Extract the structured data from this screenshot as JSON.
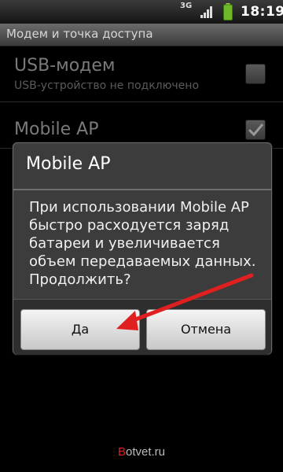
{
  "status_bar": {
    "network": "3G",
    "time": "18:19",
    "icons": [
      "network-3g-icon",
      "signal-icon",
      "battery-icon"
    ]
  },
  "title_bar": {
    "title": "Модем и точка доступа"
  },
  "settings": [
    {
      "title": "USB-модем",
      "subtitle": "USB-устройство не подключено",
      "checked": false
    },
    {
      "title": "Mobile AP",
      "subtitle": "",
      "checked": true
    }
  ],
  "dialog": {
    "title": "Mobile AP",
    "message": "При использовании Mobile AP быстро расходуется заряд батареи и увеличивается объем передаваемых данных. Продолжить?",
    "buttons": {
      "yes": "Да",
      "no": "Отмена"
    }
  },
  "annotation": {
    "arrow_color": "#e02020"
  },
  "watermark": {
    "letter": "B",
    "rest": "otvet.ru"
  }
}
